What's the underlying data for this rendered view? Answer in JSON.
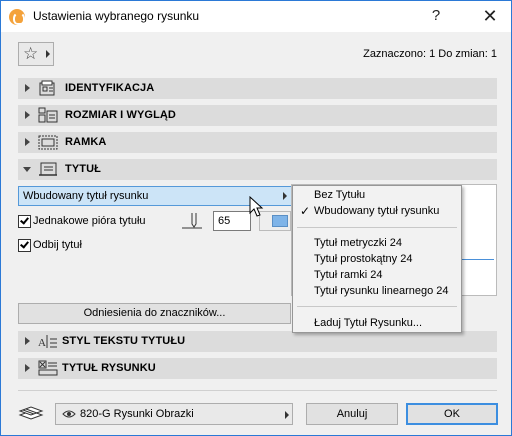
{
  "window": {
    "title": "Ustawienia wybranego rysunku"
  },
  "header": {
    "selection_info": "Zaznaczono: 1 Do zmian: 1"
  },
  "sections": {
    "identification": "IDENTYFIKACJA",
    "size_layout": "ROZMIAR I WYGLĄD",
    "frame": "RAMKA",
    "title": "TYTUŁ",
    "title_text_style": "STYL TEKSTU TYTUŁU",
    "drawing_title": "TYTUŁ RYSUNKU"
  },
  "title_panel": {
    "dropdown_value": "Wbudowany tytuł rysunku",
    "same_pens_label": "Jednakowe pióra tytułu",
    "same_pens_checked": true,
    "pen_number": "65",
    "mirror_label": "Odbij tytuł",
    "mirror_checked": true,
    "references_button": "Odniesienia do znaczników..."
  },
  "menu": {
    "items": [
      "Bez Tytułu",
      "Wbudowany tytuł rysunku",
      "Tytuł metryczki 24",
      "Tytuł prostokątny 24",
      "Tytuł ramki 24",
      "Tytuł rysunku linearnego 24",
      "Ładuj Tytuł Rysunku..."
    ],
    "checked_item": "Wbudowany tytuł rysunku"
  },
  "footer": {
    "layer": "820-G Rysunki Obrazki",
    "cancel_label": "Anuluj",
    "ok_label": "OK"
  },
  "colors": {
    "accent": "#3c8ee0",
    "selection": "#cce4f7",
    "pen_color": "#7fb4e8",
    "section_bg": "#dcdcdc"
  },
  "icons": [
    "app-icon",
    "help-icon",
    "close-icon",
    "star-icon",
    "pen-icon",
    "eye-icon",
    "layer-icon",
    "cursor-icon"
  ]
}
